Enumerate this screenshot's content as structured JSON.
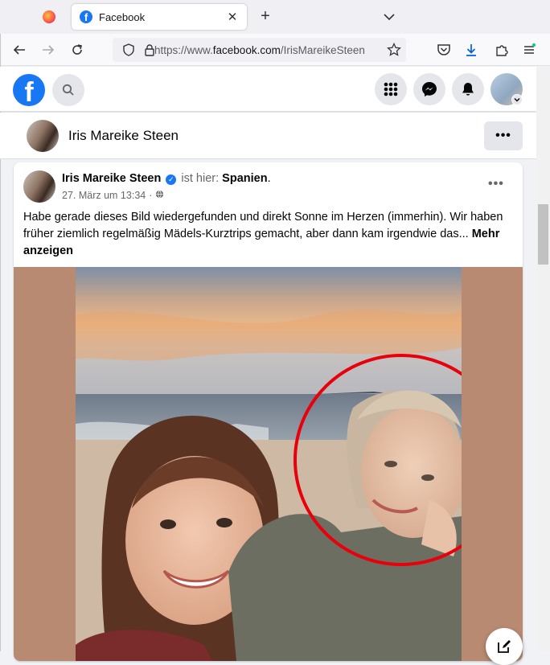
{
  "browser": {
    "tab_title": "Facebook",
    "tab_favicon_letter": "f",
    "url_prefix": "https://www.",
    "url_host": "facebook.com",
    "url_path": "/IrisMareikeSteen"
  },
  "facebook": {
    "logo_letter": "f"
  },
  "profile_bar": {
    "name": "Iris Mareike Steen",
    "more_label": "•••"
  },
  "post": {
    "author": "Iris Mareike Steen",
    "verified_mark": "✓",
    "location_prefix": "ist hier:",
    "location": "Spanien",
    "location_suffix": ".",
    "date": "27. März um 13:34",
    "separator": "·",
    "more_label": "•••",
    "text": "Habe gerade dieses Bild wiedergefunden und direkt Sonne im Herzen (immerhin). Wir haben früher ziemlich regelmäßig Mädels-Kurztrips gemacht, aber dann kam irgendwie das... ",
    "see_more": "Mehr anzeigen"
  },
  "colors": {
    "fb_blue": "#1877f2",
    "photo_background": "#b98a72",
    "annotation_circle": "#e8000b"
  },
  "icons": {
    "back": "arrow-left-icon",
    "forward": "arrow-right-icon",
    "reload": "reload-icon",
    "search": "search-icon",
    "menu": "grid-menu-icon",
    "messenger": "messenger-icon",
    "notifications": "bell-icon",
    "edit": "compose-icon",
    "globe": "globe-icon"
  }
}
